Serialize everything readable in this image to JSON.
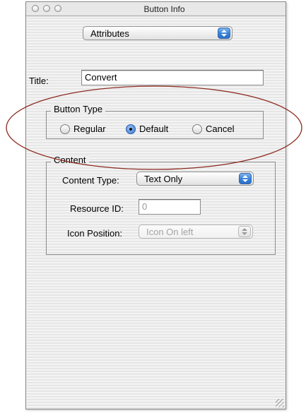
{
  "window": {
    "title": "Button Info"
  },
  "pane_selector": {
    "selected": "Attributes"
  },
  "title_field": {
    "label": "Title:",
    "value": "Convert"
  },
  "button_type": {
    "group_label": "Button Type",
    "options": [
      {
        "label": "Regular",
        "selected": false
      },
      {
        "label": "Default",
        "selected": true
      },
      {
        "label": "Cancel",
        "selected": false
      }
    ]
  },
  "content": {
    "group_label": "Content",
    "content_type": {
      "label": "Content Type:",
      "value": "Text Only"
    },
    "resource_id": {
      "label": "Resource ID:",
      "value": "0"
    },
    "icon_position": {
      "label": "Icon Position:",
      "value": "Icon On left",
      "enabled": false
    }
  },
  "colors": {
    "annotation_ellipse": "#8b2a1f",
    "accent": "#3b83db"
  }
}
